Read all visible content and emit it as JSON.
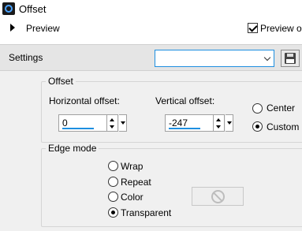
{
  "window": {
    "title": "Offset",
    "app_icon": "app-logo-icon"
  },
  "preview": {
    "label": "Preview",
    "toggle_icon": "triangle-right-icon",
    "checkbox_label": "Preview on",
    "checkbox_checked": true
  },
  "settings": {
    "label": "Settings",
    "combo_value": "",
    "save_icon": "floppy-disk-icon"
  },
  "offset_group": {
    "title": "Offset",
    "horizontal": {
      "label": "Horizontal offset:",
      "value": "0"
    },
    "vertical": {
      "label": "Vertical offset:",
      "value": "-247"
    },
    "radios": [
      {
        "label": "Center",
        "selected": false
      },
      {
        "label": "Custom",
        "selected": true
      }
    ]
  },
  "edge_group": {
    "title": "Edge mode",
    "options": [
      {
        "label": "Wrap",
        "selected": false
      },
      {
        "label": "Repeat",
        "selected": false
      },
      {
        "label": "Color",
        "selected": false
      },
      {
        "label": "Transparent",
        "selected": true
      }
    ],
    "color_button_icon": "no-color-icon"
  },
  "colors": {
    "accent": "#1e8fe0"
  }
}
